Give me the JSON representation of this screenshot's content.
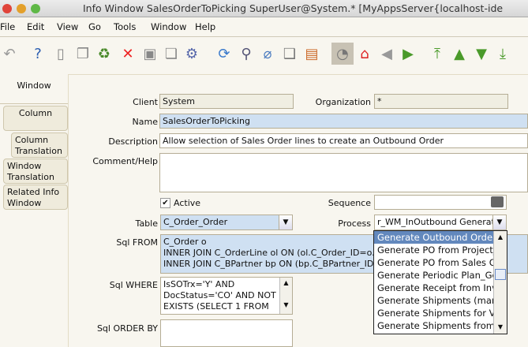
{
  "window": {
    "title": "Info Window  SalesOrderToPicking  SuperUser@System.* [MyAppsServer{localhost-ide"
  },
  "menu": [
    "File",
    "Edit",
    "View",
    "Go",
    "Tools",
    "Window",
    "Help"
  ],
  "toolbar": [
    {
      "icon": "undo-icon",
      "glyph": "↶",
      "color": "#999"
    },
    {
      "icon": "help-icon",
      "glyph": "?",
      "color": "#2a5db0"
    },
    {
      "icon": "new-record-icon",
      "glyph": "▯",
      "color": "#888"
    },
    {
      "icon": "copy-record-icon",
      "glyph": "❐",
      "color": "#888"
    },
    {
      "icon": "delete-icon",
      "glyph": "♻",
      "color": "#4a8a2a"
    },
    {
      "icon": "delete-selection-icon",
      "glyph": "✕",
      "color": "#e22"
    },
    {
      "icon": "save-icon",
      "glyph": "▣",
      "color": "#888"
    },
    {
      "icon": "save-new-icon",
      "glyph": "❏",
      "color": "#888"
    },
    {
      "icon": "settings-gear-icon",
      "glyph": "⚙",
      "color": "#5566aa"
    },
    {
      "icon": "refresh-icon",
      "glyph": "⟳",
      "color": "#3a7acc"
    },
    {
      "icon": "search-icon",
      "glyph": "⚲",
      "color": "#557"
    },
    {
      "icon": "attachment-icon",
      "glyph": "⌀",
      "color": "#4a7bc0"
    },
    {
      "icon": "chat-icon",
      "glyph": "❑",
      "color": "#777"
    },
    {
      "icon": "grid-toggle-icon",
      "glyph": "▤",
      "color": "#cc6a2a"
    },
    {
      "icon": "history-icon",
      "glyph": "◔",
      "color": "#777"
    },
    {
      "icon": "home-icon",
      "glyph": "⌂",
      "color": "#d22"
    },
    {
      "icon": "previous-icon",
      "glyph": "◀",
      "color": "#999"
    },
    {
      "icon": "next-icon",
      "glyph": "▶",
      "color": "#4a9a2a"
    },
    {
      "icon": "first-record-icon",
      "glyph": "⤒",
      "color": "#4a9a2a"
    },
    {
      "icon": "previous-record-icon",
      "glyph": "▲",
      "color": "#4a9a2a"
    },
    {
      "icon": "next-record-icon",
      "glyph": "▼",
      "color": "#4a9a2a"
    },
    {
      "icon": "last-record-icon",
      "glyph": "⤓",
      "color": "#4a9a2a"
    }
  ],
  "tabs": [
    "Window",
    "Column",
    "Column Translation",
    "Window Translation",
    "Related Info Window"
  ],
  "form": {
    "client_label": "Client",
    "client": "System",
    "org_label": "Organization",
    "org": "*",
    "name_label": "Name",
    "name": "SalesOrderToPicking",
    "description_label": "Description",
    "description": "Allow selection of Sales Order lines to create an Outbound Order",
    "comment_label": "Comment/Help",
    "comment": "",
    "active_label": "Active",
    "active": true,
    "sequence_label": "Sequence",
    "sequence": "",
    "table_label": "Table",
    "table": "C_Order_Order",
    "process_label": "Process",
    "process": "r_WM_InOutbound Generate",
    "sqlfrom_label": "Sql FROM",
    "sqlfrom": [
      "C_Order o",
      "INNER JOIN C_OrderLine ol ON (ol.C_Order_ID=o.C",
      "INNER JOIN C_BPartner bp ON (bp.C_BPartner_ID="
    ],
    "sqlwhere_label": "Sql WHERE",
    "sqlwhere": [
      "IsSOTrx='Y' AND",
      "DocStatus='CO' AND NOT",
      "EXISTS (SELECT 1 FROM"
    ],
    "sqlorder_label": "Sql ORDER BY",
    "sqlorder": ""
  },
  "process_dropdown": [
    "Generate Outbound Order_W",
    "Generate PO from Project_C",
    "Generate PO from Sales Ord",
    "Generate Periodic Plan_Gene",
    "Generate Receipt from Invoi",
    "Generate Shipments (manua",
    "Generate Shipments for Ven",
    "Generate Shipments from O"
  ]
}
